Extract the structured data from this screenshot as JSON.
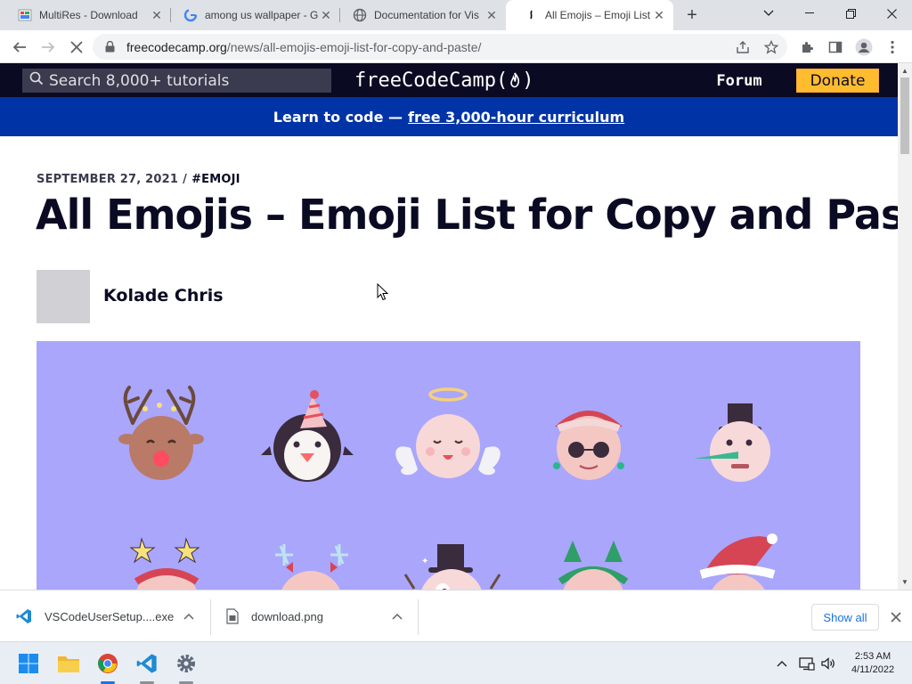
{
  "browser": {
    "tabs": [
      {
        "title": "MultiRes - Download",
        "favicon": "multires-favicon",
        "active": false
      },
      {
        "title": "among us wallpaper - G",
        "favicon": "google-favicon",
        "active": false
      },
      {
        "title": "Documentation for Vis",
        "favicon": "globe-favicon",
        "active": false
      },
      {
        "title": "All Emojis – Emoji List f",
        "favicon": "fcc-favicon",
        "active": true
      }
    ],
    "url_host": "freecodecamp.org",
    "url_path": "/news/all-emojis-emoji-list-for-copy-and-paste/"
  },
  "site": {
    "search_placeholder": "Search 8,000+ tutorials",
    "logo_text": "freeCodeCamp(",
    "logo_close": ")",
    "forum_label": "Forum",
    "donate_label": "Donate",
    "banner_prefix": "Learn to code —",
    "banner_link": "free 3,000-hour curriculum"
  },
  "article": {
    "date": "SEPTEMBER 27, 2021",
    "separator": "/",
    "tag": "#EMOJI",
    "title": "All Emojis – Emoji List for Copy and Paste",
    "author": "Kolade Chris"
  },
  "downloads": {
    "items": [
      {
        "name": "VSCodeUserSetup....exe",
        "icon": "vscode-icon"
      },
      {
        "name": "download.png",
        "icon": "image-file-icon"
      }
    ],
    "show_all_label": "Show all"
  },
  "taskbar": {
    "time": "2:53 AM",
    "date": "4/11/2022"
  },
  "colors": {
    "fcc_dark": "#0a0a23",
    "banner_blue": "#0033a6",
    "donate_yellow": "#febc2e",
    "hero_purple": "#a9a6fc"
  }
}
